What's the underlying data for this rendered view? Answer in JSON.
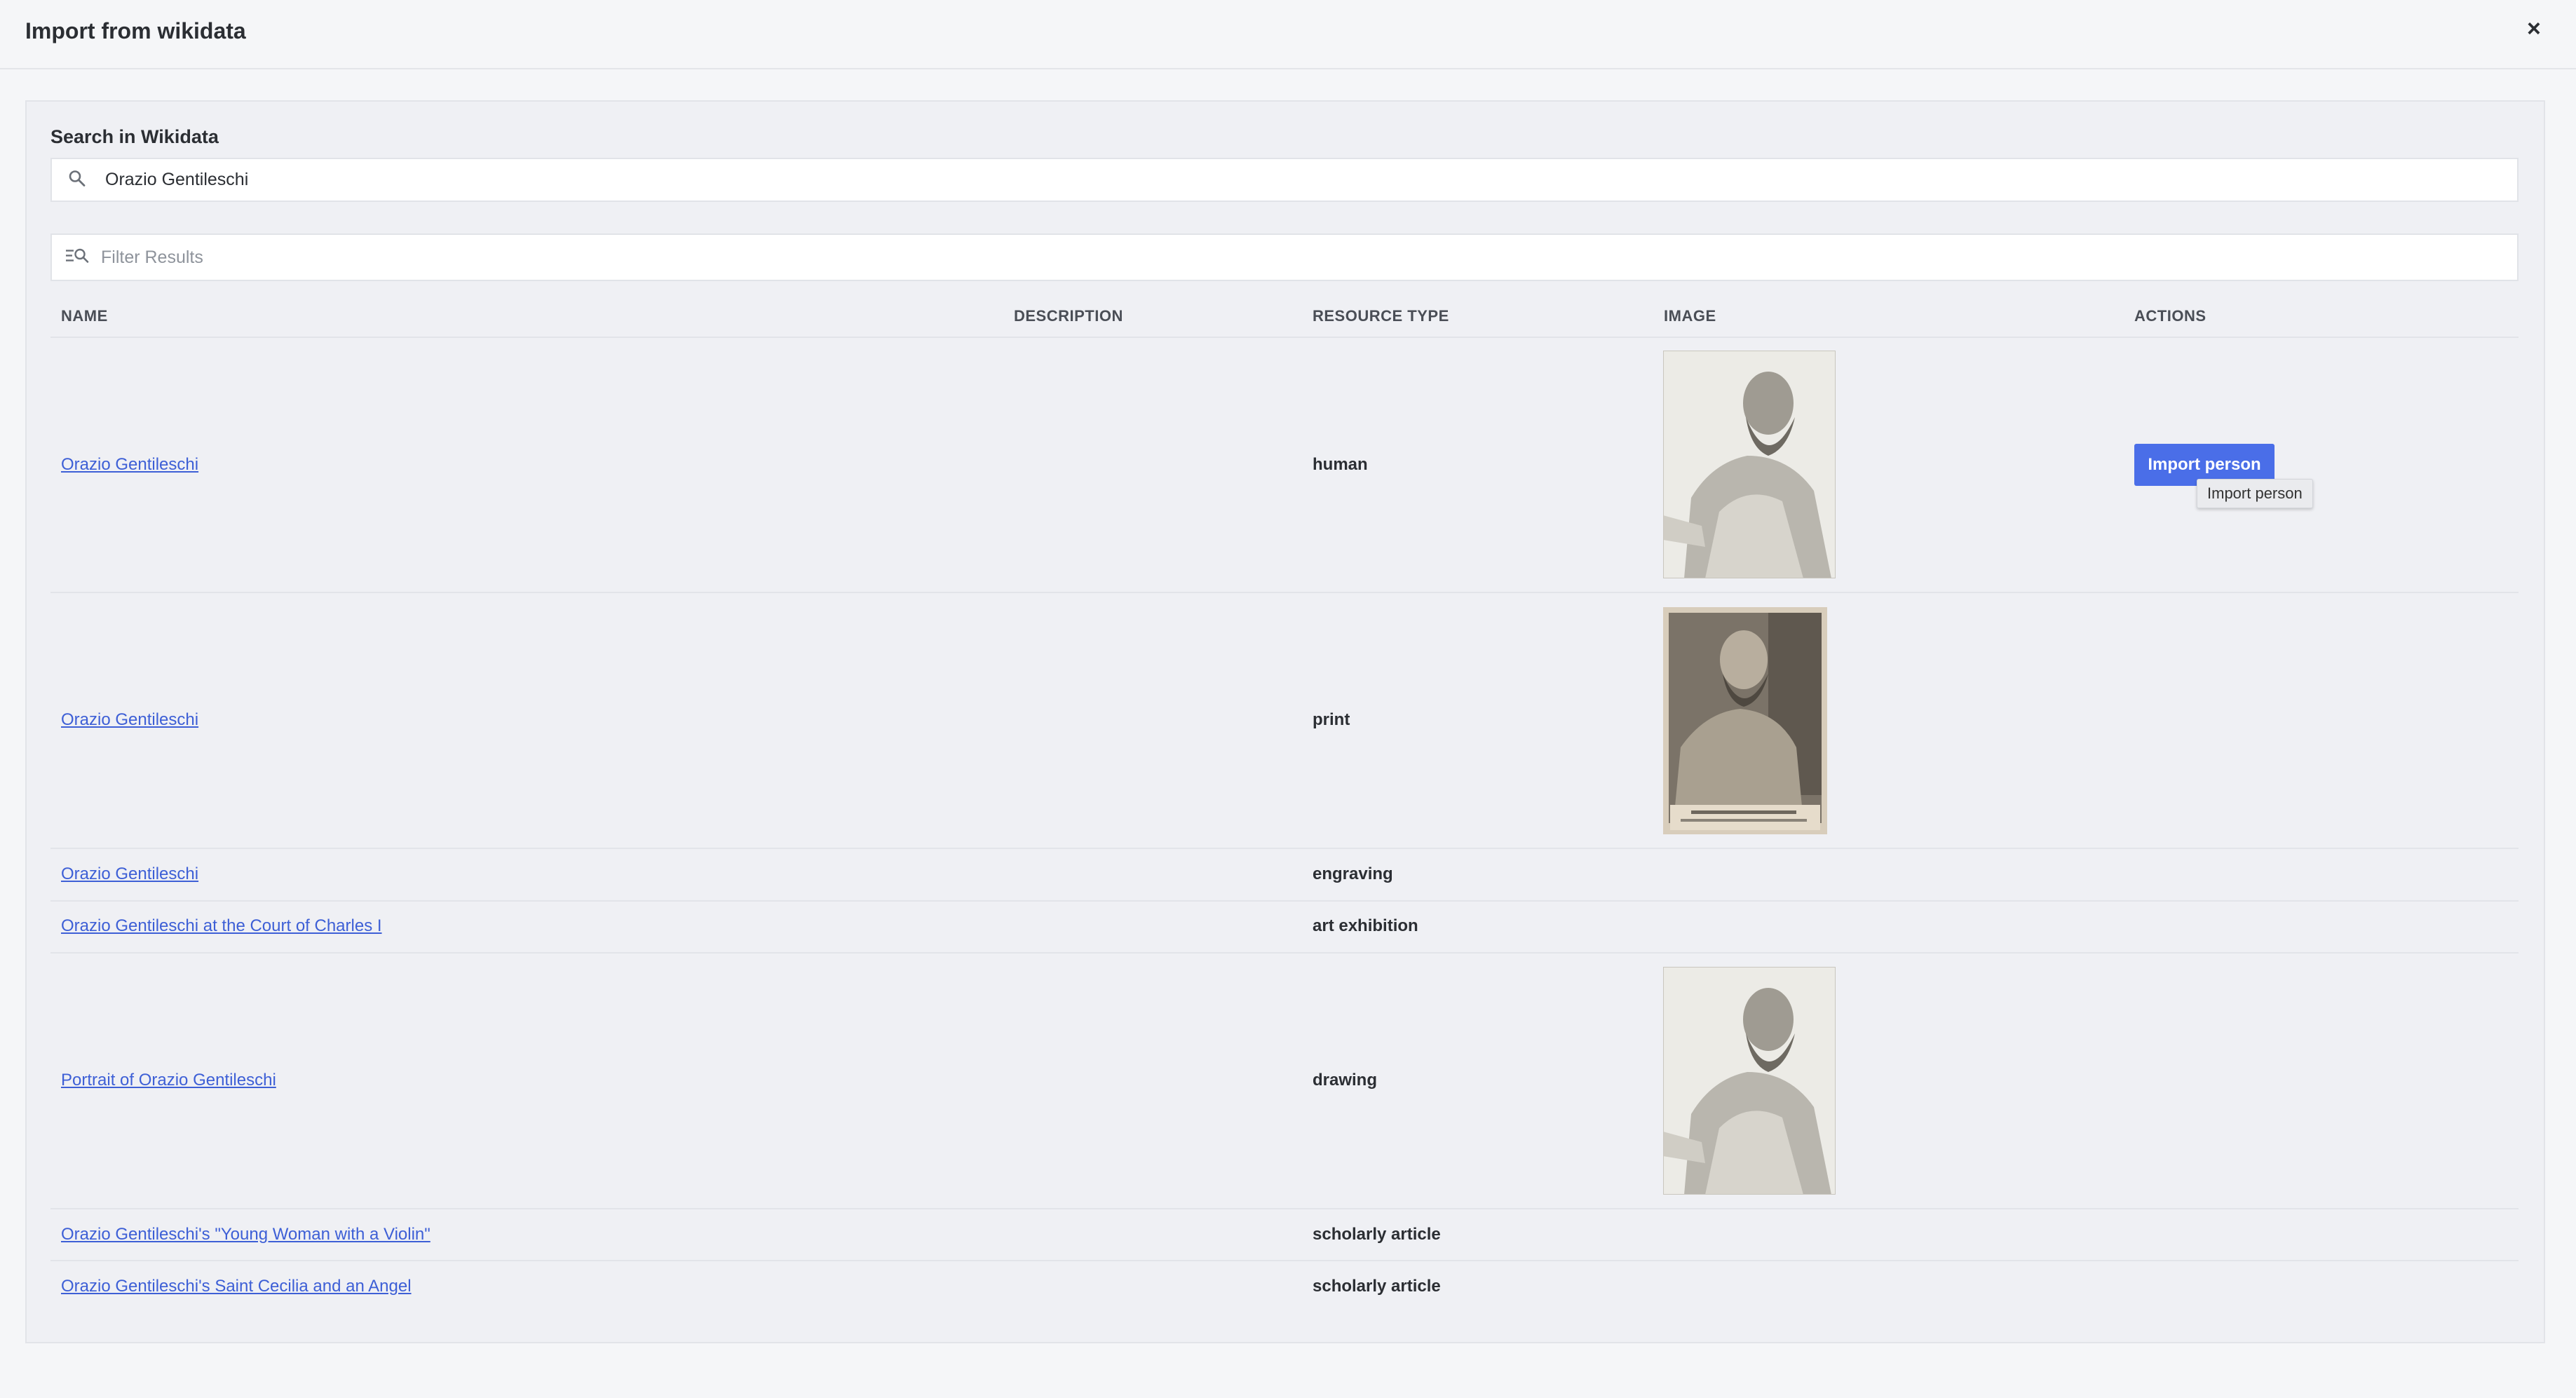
{
  "modal": {
    "title": "Import from wikidata",
    "close_label": "×"
  },
  "search": {
    "label": "Search in Wikidata",
    "value": "Orazio Gentileschi"
  },
  "filter": {
    "placeholder": "Filter Results",
    "value": ""
  },
  "table": {
    "headers": {
      "name": "NAME",
      "description": "DESCRIPTION",
      "resource_type": "RESOURCE TYPE",
      "image": "IMAGE",
      "actions": "ACTIONS"
    },
    "rows": [
      {
        "name": "Orazio Gentileschi",
        "description": "",
        "resource_type": "human",
        "has_image": true
      },
      {
        "name": "Orazio Gentileschi",
        "description": "",
        "resource_type": "print",
        "has_image": true
      },
      {
        "name": "Orazio Gentileschi",
        "description": "",
        "resource_type": "engraving",
        "has_image": false
      },
      {
        "name": "Orazio Gentileschi at the Court of Charles I",
        "description": "",
        "resource_type": "art exhibition",
        "has_image": false
      },
      {
        "name": "Portrait of Orazio Gentileschi",
        "description": "",
        "resource_type": "drawing",
        "has_image": true
      },
      {
        "name": "Orazio Gentileschi's \"Young Woman with a Violin\"",
        "description": "",
        "resource_type": "scholarly article",
        "has_image": false
      },
      {
        "name": "Orazio Gentileschi's Saint Cecilia and an Angel",
        "description": "",
        "resource_type": "scholarly article",
        "has_image": false
      }
    ]
  },
  "actions": {
    "import_label": "Import person",
    "tooltip": "Import person"
  },
  "icons": {
    "search": "search-icon",
    "filter": "filter-search-icon",
    "close": "close-icon"
  },
  "colors": {
    "accent": "#4a6ee8",
    "link": "#3d5fd6",
    "background": "#f5f6f8",
    "panel": "#eff0f4"
  }
}
